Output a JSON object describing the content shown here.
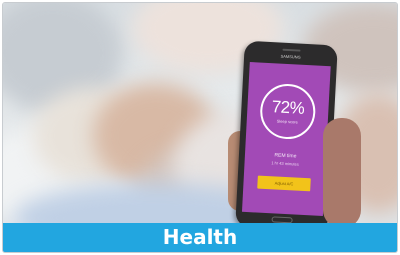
{
  "banner": {
    "title": "Health"
  },
  "phone": {
    "brand": "SAMSUNG",
    "sleep_score": "72%",
    "sleep_score_label": "Sleep score",
    "rem_title": "REM time",
    "rem_detail": "1 hr 43 minutes",
    "action_label": "Adjust A/C",
    "screen_color": "#a24ab6",
    "button_color": "#f2c31a"
  },
  "colors": {
    "banner_bg": "#22a6e0",
    "banner_text": "#ffffff"
  }
}
